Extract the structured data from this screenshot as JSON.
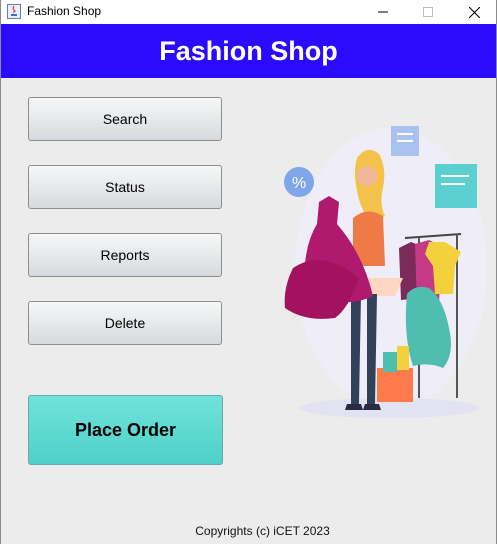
{
  "window": {
    "title": "Fashion Shop",
    "controls": {
      "minimize_icon": "minimize-icon",
      "maximize_icon": "maximize-icon",
      "close_icon": "close-icon"
    }
  },
  "header": {
    "title": "Fashion Shop",
    "background_color": "#2a0bff"
  },
  "menu": {
    "search_label": "Search",
    "status_label": "Status",
    "reports_label": "Reports",
    "delete_label": "Delete"
  },
  "order_button": {
    "label": "Place Order",
    "color": "#5ad8d0"
  },
  "illustration": {
    "icon": "fashion-shopping-illustration"
  },
  "footer": {
    "copyright": "Copyrights (c) iCET 2023"
  }
}
